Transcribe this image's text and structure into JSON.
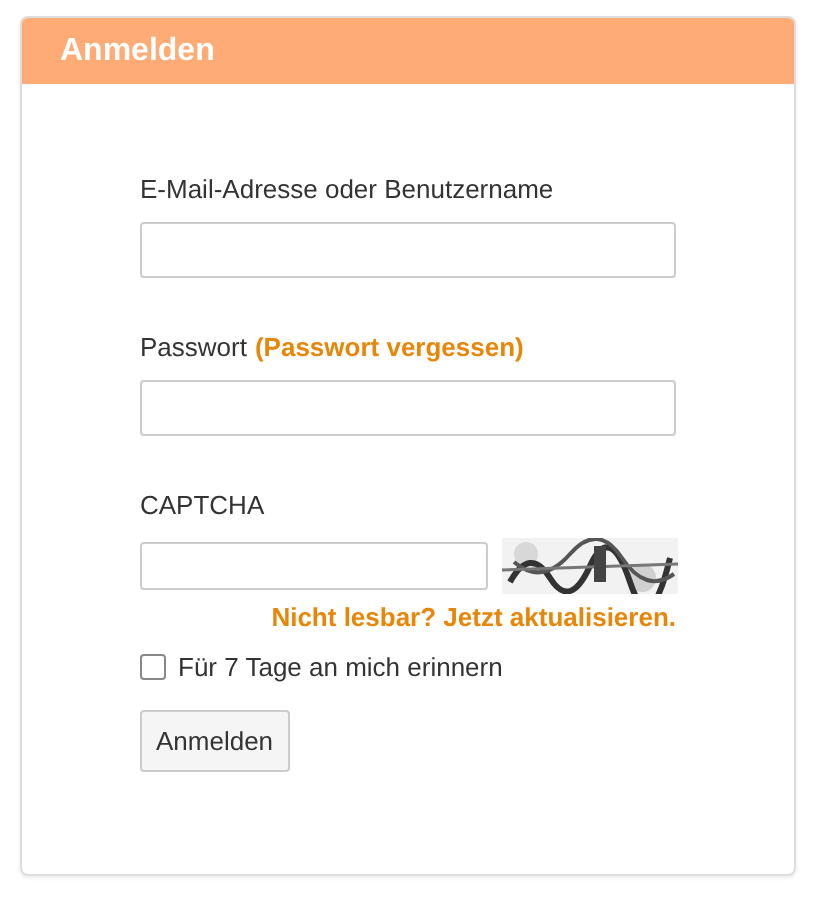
{
  "panel": {
    "title": "Anmelden"
  },
  "fields": [
    {
      "kind": "text",
      "label": "E-Mail-Adresse oder Benutzername"
    },
    {
      "kind": "password",
      "label": "Passwort",
      "link": "(Passwort vergessen)"
    },
    {
      "kind": "captcha",
      "label": "CAPTCHA",
      "link": "Nicht lesbar? Jetzt aktualisieren."
    }
  ],
  "remember": {
    "label": "Für 7 Tage an mich erinnern",
    "checked": false
  },
  "submit": "Anmelden"
}
